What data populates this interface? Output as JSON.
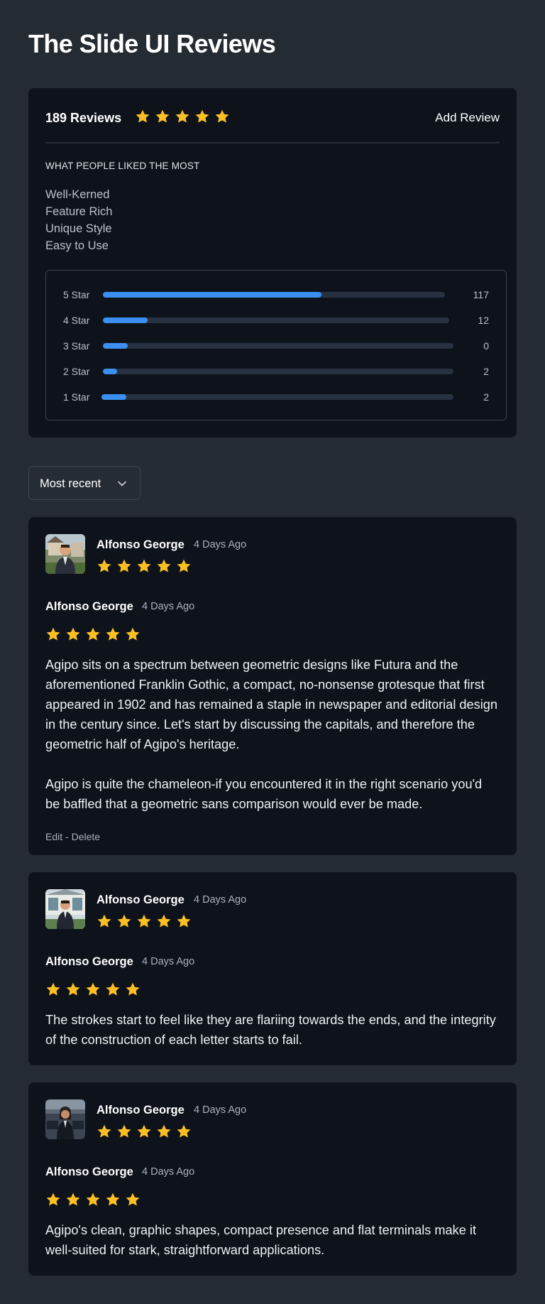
{
  "page": {
    "title": "The Slide UI Reviews"
  },
  "summary": {
    "review_count": "189 Reviews",
    "rating_stars": 5,
    "add_review_label": "Add Review",
    "liked_title": "WHAT PEOPLE LIKED THE MOST",
    "liked_items": [
      "Well-Kerned",
      "Feature Rich",
      "Unique Style",
      "Easy to Use"
    ],
    "breakdown": [
      {
        "label": "5 Star",
        "count": "117",
        "fill_percent": 64
      },
      {
        "label": "4 Star",
        "count": "12",
        "fill_percent": 13
      },
      {
        "label": "3 Star",
        "count": "0",
        "fill_percent": 7
      },
      {
        "label": "2 Star",
        "count": "2",
        "fill_percent": 4
      },
      {
        "label": "1 Star",
        "count": "2",
        "fill_percent": 7
      }
    ]
  },
  "sort": {
    "selected": "Most recent"
  },
  "colors": {
    "star": "#fbbf24",
    "bar_fill": "#3b8ff0",
    "bar_track": "#273142",
    "card_bg": "#0e131b",
    "page_bg": "#252b33"
  },
  "reviews": [
    {
      "name": "Alfonso George",
      "date": "4 Days Ago",
      "stars": 5,
      "paragraphs": [
        "Agipo sits on a spectrum between geometric designs like Futura and the aforementioned Franklin Gothic, a compact, no-nonsense grotesque that first appeared in 1902 and has remained a staple in newspaper and editorial design in the century since. Let's start by discussing the capitals, and therefore the geometric half of Agipo's heritage.",
        "Agipo is quite the chameleon-if you encountered it in the right scenario you'd be baffled that a geometric sans comparison would ever be made."
      ],
      "actions": {
        "edit": "Edit",
        "separator": " - ",
        "delete": "Delete"
      }
    },
    {
      "name": "Alfonso George",
      "date": "4 Days Ago",
      "stars": 5,
      "paragraphs": [
        "The strokes start to feel like they are flariing towards the ends, and the integrity of the construction of each letter starts to fail."
      ]
    },
    {
      "name": "Alfonso George",
      "date": "4 Days Ago",
      "stars": 5,
      "paragraphs": [
        "Agipo's clean, graphic shapes, compact presence and flat terminals make it well-suited for stark, straightforward applications."
      ]
    }
  ]
}
